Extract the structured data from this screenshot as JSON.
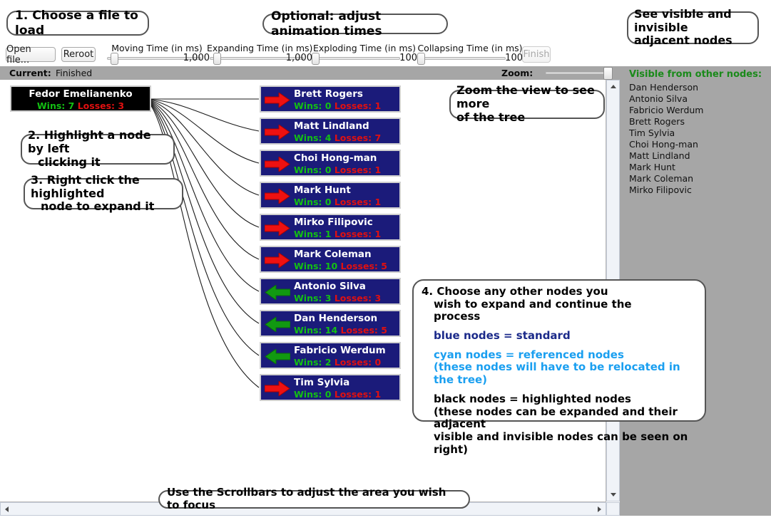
{
  "callouts": {
    "choose_file": "1. Choose a file to load",
    "animation_times": "Optional: adjust animation times",
    "adjacent_nodes_l1": "See visible and invisible",
    "adjacent_nodes_l2": "adjacent nodes",
    "highlight_l1": "2. Highlight a node by left",
    "highlight_l2": "clicking it",
    "rightclick_l1": "3. Right click the highlighted",
    "rightclick_l2": "node to expand it",
    "zoomview_l1": "Zoom the view to see more",
    "zoomview_l2": "of the tree",
    "scrollbars": "Use the Scrollbars to adjust the area you wish to focus",
    "steps": {
      "l1": "4. Choose any other nodes you",
      "l2": "wish to expand and continue the",
      "l3": "process",
      "blue": "blue nodes = standard",
      "cyan_l1": "cyan nodes = referenced nodes",
      "cyan_l2": "(these nodes will have to be relocated in the tree)",
      "black_l1": "black nodes = highlighted nodes",
      "black_l2": "(these nodes can be expanded and their adjacent",
      "black_l3": "visible and invisible nodes can be seen on right)"
    }
  },
  "toolbar": {
    "open_file_label": "Open file...",
    "reroot_label": "Reroot",
    "finish_label": "Finish",
    "sliders": [
      {
        "label": "Moving Time (in ms)",
        "value": "1,000"
      },
      {
        "label": "Expanding Time (in ms)",
        "value": "1,000"
      },
      {
        "label": "Exploding Time (in ms)",
        "value": "100"
      },
      {
        "label": "Collapsing Time (in ms)",
        "value": "100"
      }
    ]
  },
  "statusbar": {
    "current_label": "Current:",
    "current_value": "Finished",
    "zoom_label": "Zoom:"
  },
  "tree": {
    "root": {
      "name": "Fedor Emelianenko",
      "wins_label": "Wins: 7",
      "losses_label": "Losses: 3"
    },
    "nodes": [
      {
        "name": "Brett Rogers",
        "wins_label": "Wins: 0",
        "losses_label": "Losses: 1",
        "arrow": "red-right-arrow-icon"
      },
      {
        "name": "Matt Lindland",
        "wins_label": "Wins: 4",
        "losses_label": "Losses: 7",
        "arrow": "red-right-arrow-icon"
      },
      {
        "name": "Choi Hong-man",
        "wins_label": "Wins: 0",
        "losses_label": "Losses: 1",
        "arrow": "red-right-arrow-icon"
      },
      {
        "name": "Mark Hunt",
        "wins_label": "Wins: 0",
        "losses_label": "Losses: 1",
        "arrow": "red-right-arrow-icon"
      },
      {
        "name": "Mirko Filipovic",
        "wins_label": "Wins: 1",
        "losses_label": "Losses: 1",
        "arrow": "red-right-arrow-icon"
      },
      {
        "name": "Mark Coleman",
        "wins_label": "Wins: 10",
        "losses_label": "Losses: 5",
        "arrow": "red-right-arrow-icon"
      },
      {
        "name": "Antonio Silva",
        "wins_label": "Wins: 3",
        "losses_label": "Losses: 3",
        "arrow": "green-left-arrow-icon"
      },
      {
        "name": "Dan Henderson",
        "wins_label": "Wins: 14",
        "losses_label": "Losses: 5",
        "arrow": "green-left-arrow-icon"
      },
      {
        "name": "Fabricio Werdum",
        "wins_label": "Wins: 2",
        "losses_label": "Losses: 0",
        "arrow": "green-left-arrow-icon"
      },
      {
        "name": "Tim Sylvia",
        "wins_label": "Wins: 0",
        "losses_label": "Losses: 1",
        "arrow": "red-right-arrow-icon"
      }
    ]
  },
  "side_panel": {
    "title": "Visible from other nodes:",
    "items": [
      "Dan Henderson",
      "Antonio Silva",
      "Fabricio Werdum",
      "Brett Rogers",
      "Tim Sylvia",
      "Choi Hong-man",
      "Matt Lindland",
      "Mark Hunt",
      "Mark Coleman",
      "Mirko Filipovic"
    ]
  },
  "colors": {
    "node_blue": "#1b1b7a",
    "node_black": "#000000",
    "wins_green": "#13c013",
    "losses_red": "#e01010",
    "panel_gray": "#a6a6a6",
    "cyan_text": "#1a9ff0",
    "blue_text": "#1b2a8a",
    "panel_title_green": "#1a8a1a"
  }
}
